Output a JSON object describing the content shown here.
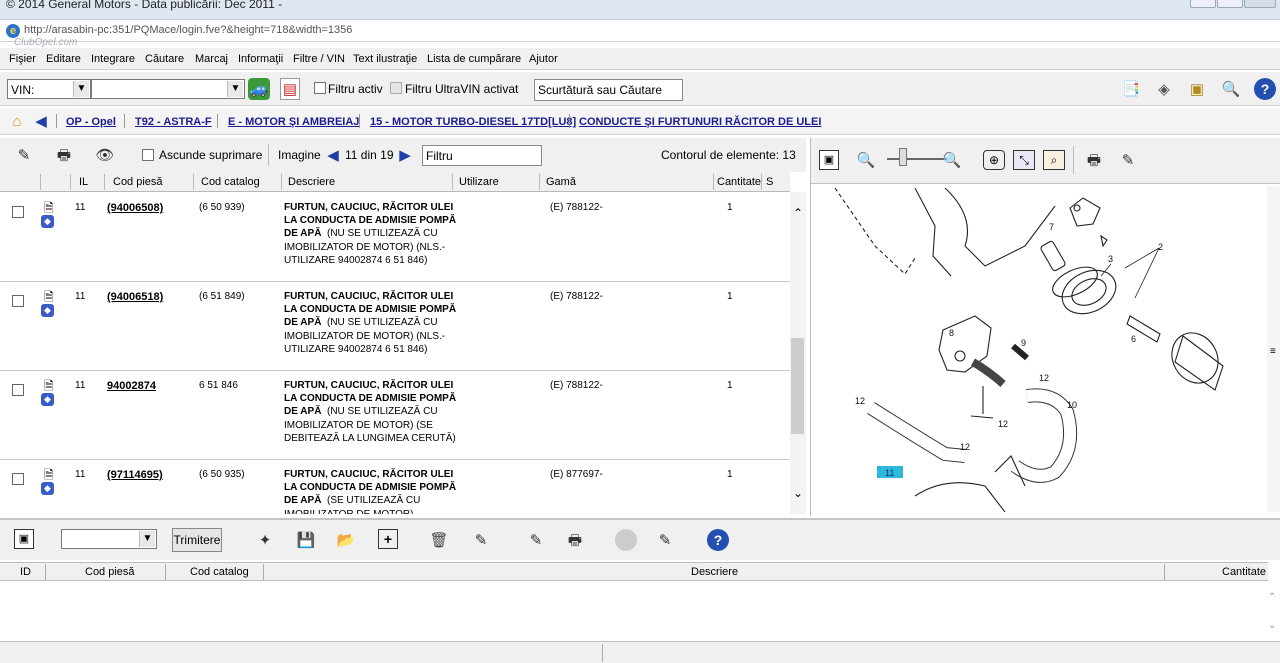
{
  "window": {
    "title": "© 2014 General Motors - Data publicării: Dec 2011 -",
    "url": "http://arasabin-pc:351/PQMace/login.fve?&height=718&width=1356",
    "watermark": "ClubOpel.com"
  },
  "menu": [
    "Fişier",
    "Editare",
    "Integrare",
    "Căutare",
    "Marcaj",
    "Informaţii",
    "Filtre / VIN",
    "Text ilustraţie",
    "Lista de cumpărare",
    "Ajutor"
  ],
  "toolbar": {
    "vin_label": "VIN:",
    "vin_value": "",
    "filter_active": "Filtru activ",
    "filter_ultravin": "Filtru UltraVIN activat",
    "search_placeholder": "Scurtătură sau Căutare"
  },
  "breadcrumb": [
    "OP - Opel",
    "T92 - ASTRA-F",
    "E - MOTOR ŞI AMBREIAJ",
    "15 - MOTOR TURBO-DIESEL 17TD[LU8]",
    "CONDUCTE ŞI FURTUNURI RĂCITOR DE ULEI"
  ],
  "list_toolbar": {
    "hide_deleted": "Ascunde suprimare",
    "image_label": "Imagine",
    "image_pos": "11 din 19",
    "filter_placeholder": "Filtru",
    "count_label": "Contorul de elemente: 13"
  },
  "columns": [
    "IL",
    "Cod piesă",
    "Cod catalog",
    "Descriere",
    "Utilizare",
    "Gamă",
    "Cantitate",
    "S"
  ],
  "rows": [
    {
      "il": "11",
      "part": "(94006508)",
      "catalog": "(6 50 939)",
      "desc_bold": "FURTUN, CAUCIUC, RĂCITOR ULEI LA CONDUCTA DE ADMISIE POMPĂ DE APĂ",
      "desc_rest": "(NU SE UTILIZEAZĂ CU IMOBILIZATOR DE MOTOR) (NLS.- UTILIZARE 94002874 6 51 846)",
      "range": "(E) 788122-",
      "qty": "1"
    },
    {
      "il": "11",
      "part": "(94006518)",
      "catalog": "(6 51 849)",
      "desc_bold": "FURTUN, CAUCIUC, RĂCITOR ULEI LA CONDUCTA DE ADMISIE POMPĂ DE APĂ",
      "desc_rest": "(NU SE UTILIZEAZĂ CU IMOBILIZATOR DE MOTOR) (NLS.- UTILIZARE 94002874 6 51 846)",
      "range": "(E) 788122-",
      "qty": "1"
    },
    {
      "il": "11",
      "part": "94002874",
      "catalog": "6 51 846",
      "desc_bold": "FURTUN, CAUCIUC, RĂCITOR ULEI LA CONDUCTA DE ADMISIE POMPĂ DE APĂ",
      "desc_rest": "(NU SE UTILIZEAZĂ CU IMOBILIZATOR DE MOTOR) (SE DEBITEAZĂ LA LUNGIMEA CERUTĂ)",
      "range": "(E) 788122-",
      "qty": "1"
    },
    {
      "il": "11",
      "part": "(97114695)",
      "catalog": "(6 50 935)",
      "desc_bold": "FURTUN, CAUCIUC, RĂCITOR ULEI LA CONDUCTA DE ADMISIE POMPĂ DE APĂ",
      "desc_rest": "(SE UTILIZEAZĂ CU IMOBILIZATOR DE MOTOR)",
      "range": "(E) 877697-",
      "qty": "1"
    }
  ],
  "diagram_labels": [
    "7",
    "2",
    "3",
    "6",
    "8",
    "9",
    "12",
    "10",
    "12",
    "12",
    "12",
    "11"
  ],
  "bottom": {
    "send_label": "Trimitere",
    "columns": [
      "ID",
      "Cod piesă",
      "Cod catalog",
      "Descriere",
      "Cantitate"
    ]
  }
}
